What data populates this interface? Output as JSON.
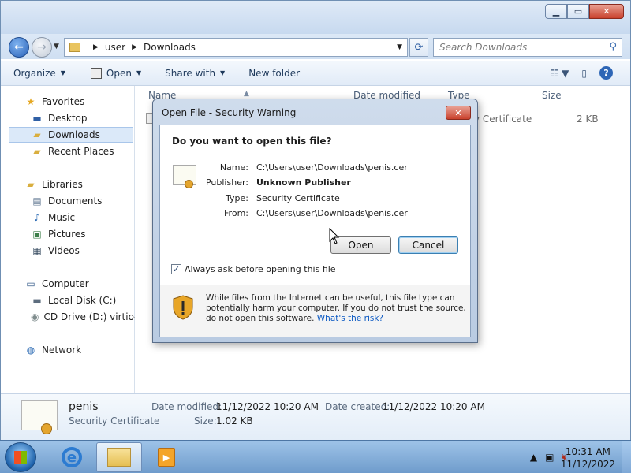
{
  "explorer": {
    "address": {
      "segments": [
        "user",
        "Downloads"
      ]
    },
    "search_placeholder": "Search Downloads",
    "toolbar": {
      "organize": "Organize",
      "open": "Open",
      "share_with": "Share with",
      "new_folder": "New folder"
    },
    "nav": {
      "favorites": "Favorites",
      "desktop": "Desktop",
      "downloads": "Downloads",
      "recent_places": "Recent Places",
      "libraries": "Libraries",
      "documents": "Documents",
      "music": "Music",
      "pictures": "Pictures",
      "videos": "Videos",
      "computer": "Computer",
      "local_disk": "Local Disk (C:)",
      "cd_drive": "CD Drive (D:) virtio-w",
      "network": "Network"
    },
    "columns": {
      "name": "Name",
      "date_modified": "Date modified",
      "type": "Type",
      "size": "Size"
    },
    "file_row": {
      "type": "y Certificate",
      "size": "2 KB"
    },
    "details": {
      "name": "penis",
      "type": "Security Certificate",
      "date_modified_label": "Date modified:",
      "date_modified": "11/12/2022 10:20 AM",
      "date_created_label": "Date created:",
      "date_created": "11/12/2022 10:20 AM",
      "size_label": "Size:",
      "size": "1.02 KB"
    }
  },
  "dialog": {
    "title": "Open File - Security Warning",
    "question": "Do you want to open this file?",
    "fields": {
      "name_label": "Name:",
      "name": "C:\\Users\\user\\Downloads\\penis.cer",
      "publisher_label": "Publisher:",
      "publisher": "Unknown Publisher",
      "type_label": "Type:",
      "type": "Security Certificate",
      "from_label": "From:",
      "from": "C:\\Users\\user\\Downloads\\penis.cer"
    },
    "open_button": "Open",
    "cancel_button": "Cancel",
    "checkbox_label": "Always ask before opening this file",
    "checkbox_checked": true,
    "warning_text": "While files from the Internet can be useful, this file type can potentially harm your computer. If you do not trust the source, do not open this software.",
    "warning_link": "What's the risk?"
  },
  "taskbar": {
    "time": "10:31 AM",
    "date": "11/12/2022"
  },
  "colors": {
    "accent": "#2e66b6",
    "close_red": "#c9412d",
    "link": "#0a58c2"
  }
}
